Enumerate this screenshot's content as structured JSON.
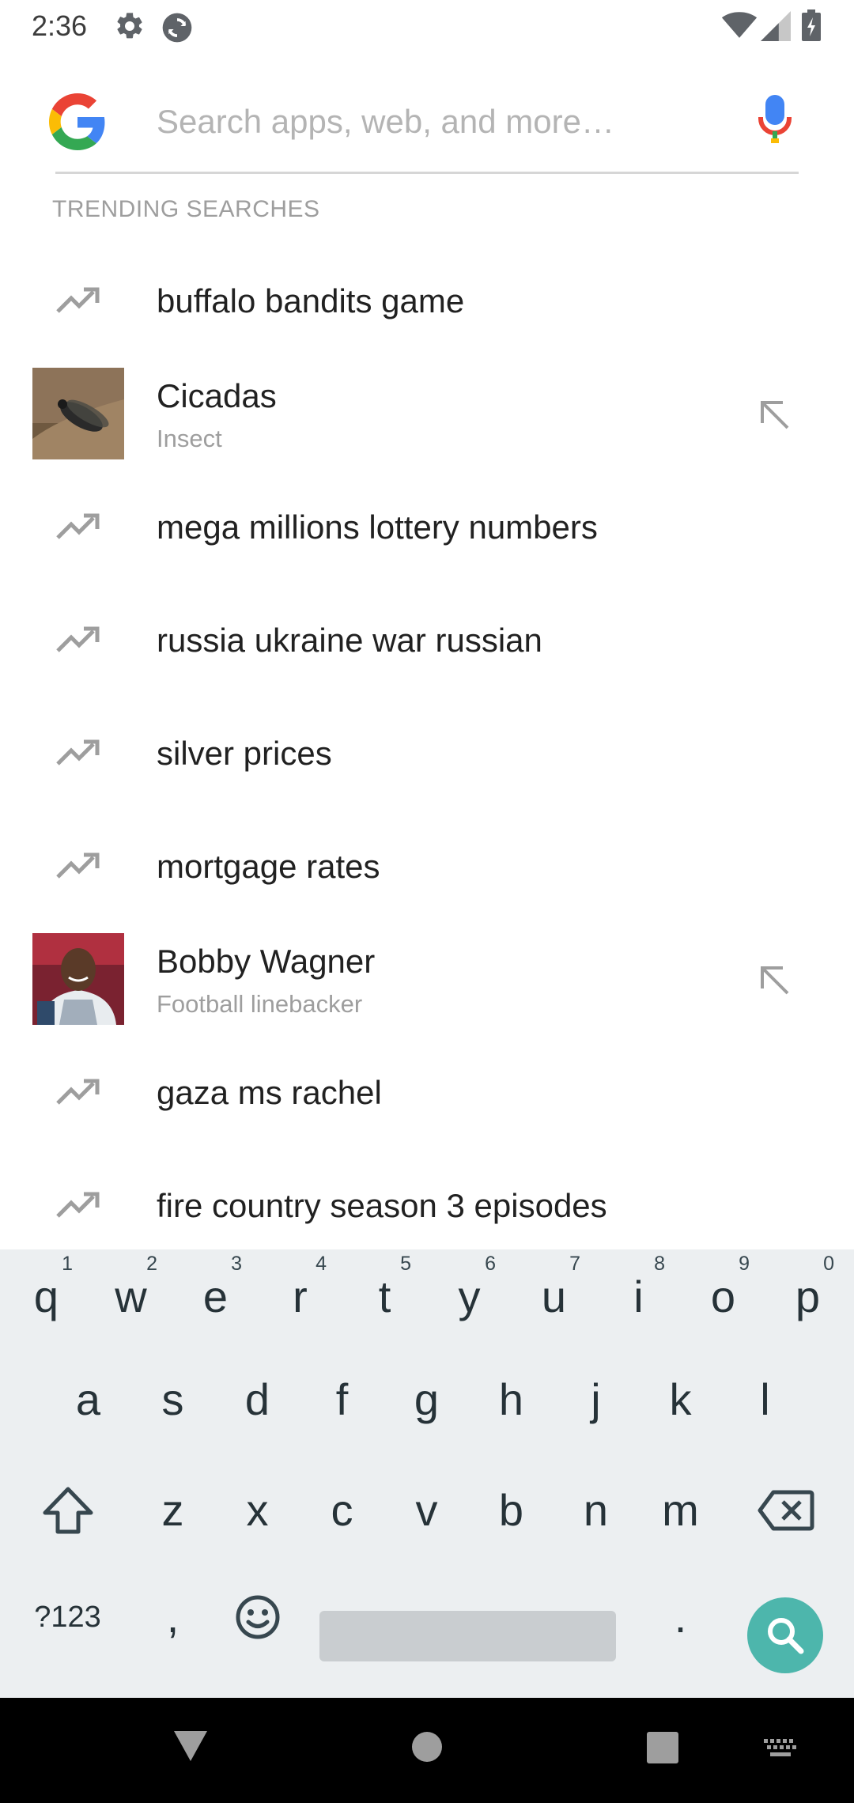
{
  "status_bar": {
    "time": "2:36",
    "icons": [
      "gear-icon",
      "sync-icon",
      "wifi-icon",
      "signal-icon",
      "battery-icon"
    ]
  },
  "search": {
    "placeholder": "Search apps, web, and more…",
    "value": "",
    "logo": "google-g-icon",
    "voice_icon": "microphone-icon"
  },
  "trending": {
    "header": "TRENDING SEARCHES",
    "items": [
      {
        "type": "query",
        "text": "buffalo bandits game",
        "icon": "trending-up-icon"
      },
      {
        "type": "entity",
        "title": "Cicadas",
        "subtitle": "Insect",
        "image": "cicada-thumbnail",
        "action_icon": "fill-query-arrow-icon"
      },
      {
        "type": "query",
        "text": "mega millions lottery numbers",
        "icon": "trending-up-icon"
      },
      {
        "type": "query",
        "text": "russia ukraine war russian",
        "icon": "trending-up-icon"
      },
      {
        "type": "query",
        "text": "silver prices",
        "icon": "trending-up-icon"
      },
      {
        "type": "query",
        "text": "mortgage rates",
        "icon": "trending-up-icon"
      },
      {
        "type": "entity",
        "title": "Bobby Wagner",
        "subtitle": "Football linebacker",
        "image": "bobby-wagner-thumbnail",
        "action_icon": "fill-query-arrow-icon"
      },
      {
        "type": "query",
        "text": "gaza ms rachel",
        "icon": "trending-up-icon"
      },
      {
        "type": "query",
        "text": "fire country season 3 episodes",
        "icon": "trending-up-icon"
      }
    ]
  },
  "keyboard": {
    "row1": [
      {
        "key": "q",
        "hint": "1"
      },
      {
        "key": "w",
        "hint": "2"
      },
      {
        "key": "e",
        "hint": "3"
      },
      {
        "key": "r",
        "hint": "4"
      },
      {
        "key": "t",
        "hint": "5"
      },
      {
        "key": "y",
        "hint": "6"
      },
      {
        "key": "u",
        "hint": "7"
      },
      {
        "key": "i",
        "hint": "8"
      },
      {
        "key": "o",
        "hint": "9"
      },
      {
        "key": "p",
        "hint": "0"
      }
    ],
    "row2": [
      "a",
      "s",
      "d",
      "f",
      "g",
      "h",
      "j",
      "k",
      "l"
    ],
    "row3": [
      "z",
      "x",
      "c",
      "v",
      "b",
      "n",
      "m"
    ],
    "symbols_label": "?123",
    "comma": ",",
    "period": ".",
    "shift_icon": "shift-icon",
    "backspace_icon": "backspace-icon",
    "emoji_icon": "emoji-icon",
    "action_icon": "search-icon"
  },
  "nav_bar": {
    "icons": [
      "back-icon",
      "home-icon",
      "recents-icon",
      "keyboard-switch-icon"
    ]
  },
  "colors": {
    "accent": "#4db6ac",
    "keyboard_bg": "#eceff1",
    "primary_text": "#212121",
    "secondary_text": "#9e9e9e"
  }
}
